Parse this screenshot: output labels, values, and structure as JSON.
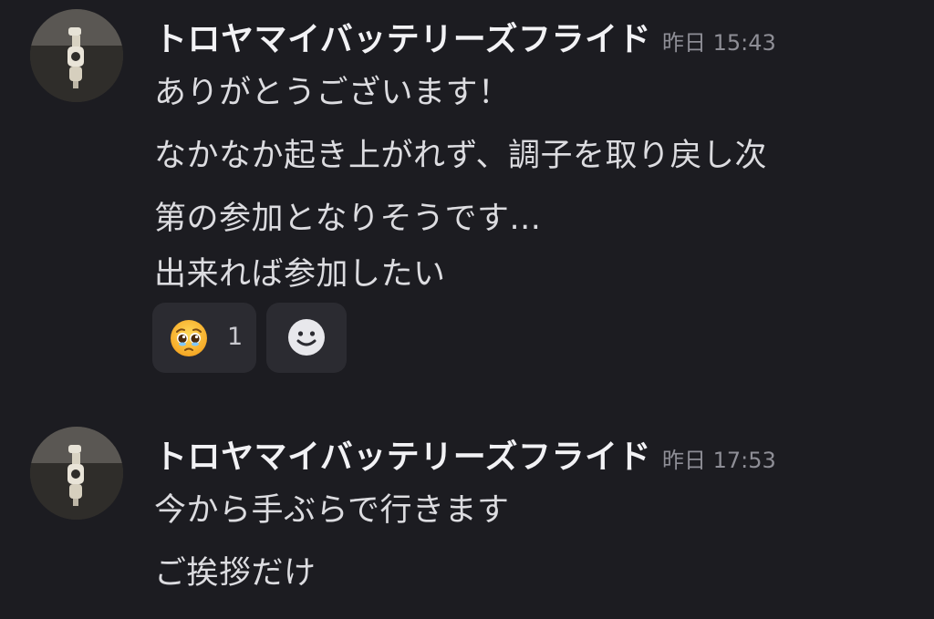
{
  "messages": [
    {
      "username": "トロヤマイバッテリーズフライド",
      "timestamp": "昨日 15:43",
      "lines": [
        "ありがとうございます！",
        "なかなか起き上がれず、調子を取り戻し次",
        "第の参加となりそうです...",
        "出来れば参加したい"
      ],
      "reactions": [
        {
          "icon": "pleading-face-emoji",
          "count": "1"
        },
        {
          "icon": "add-reaction-smiley-icon"
        }
      ]
    },
    {
      "username": "トロヤマイバッテリーズフライド",
      "timestamp": "昨日 17:53",
      "lines": [
        "今から手ぶらで行きます",
        "ご挨拶だけ"
      ]
    }
  ],
  "colors": {
    "background": "#1c1c21",
    "reaction_bg": "#2b2b31",
    "timestamp": "#8e8e96",
    "text": "#dcdce0"
  }
}
